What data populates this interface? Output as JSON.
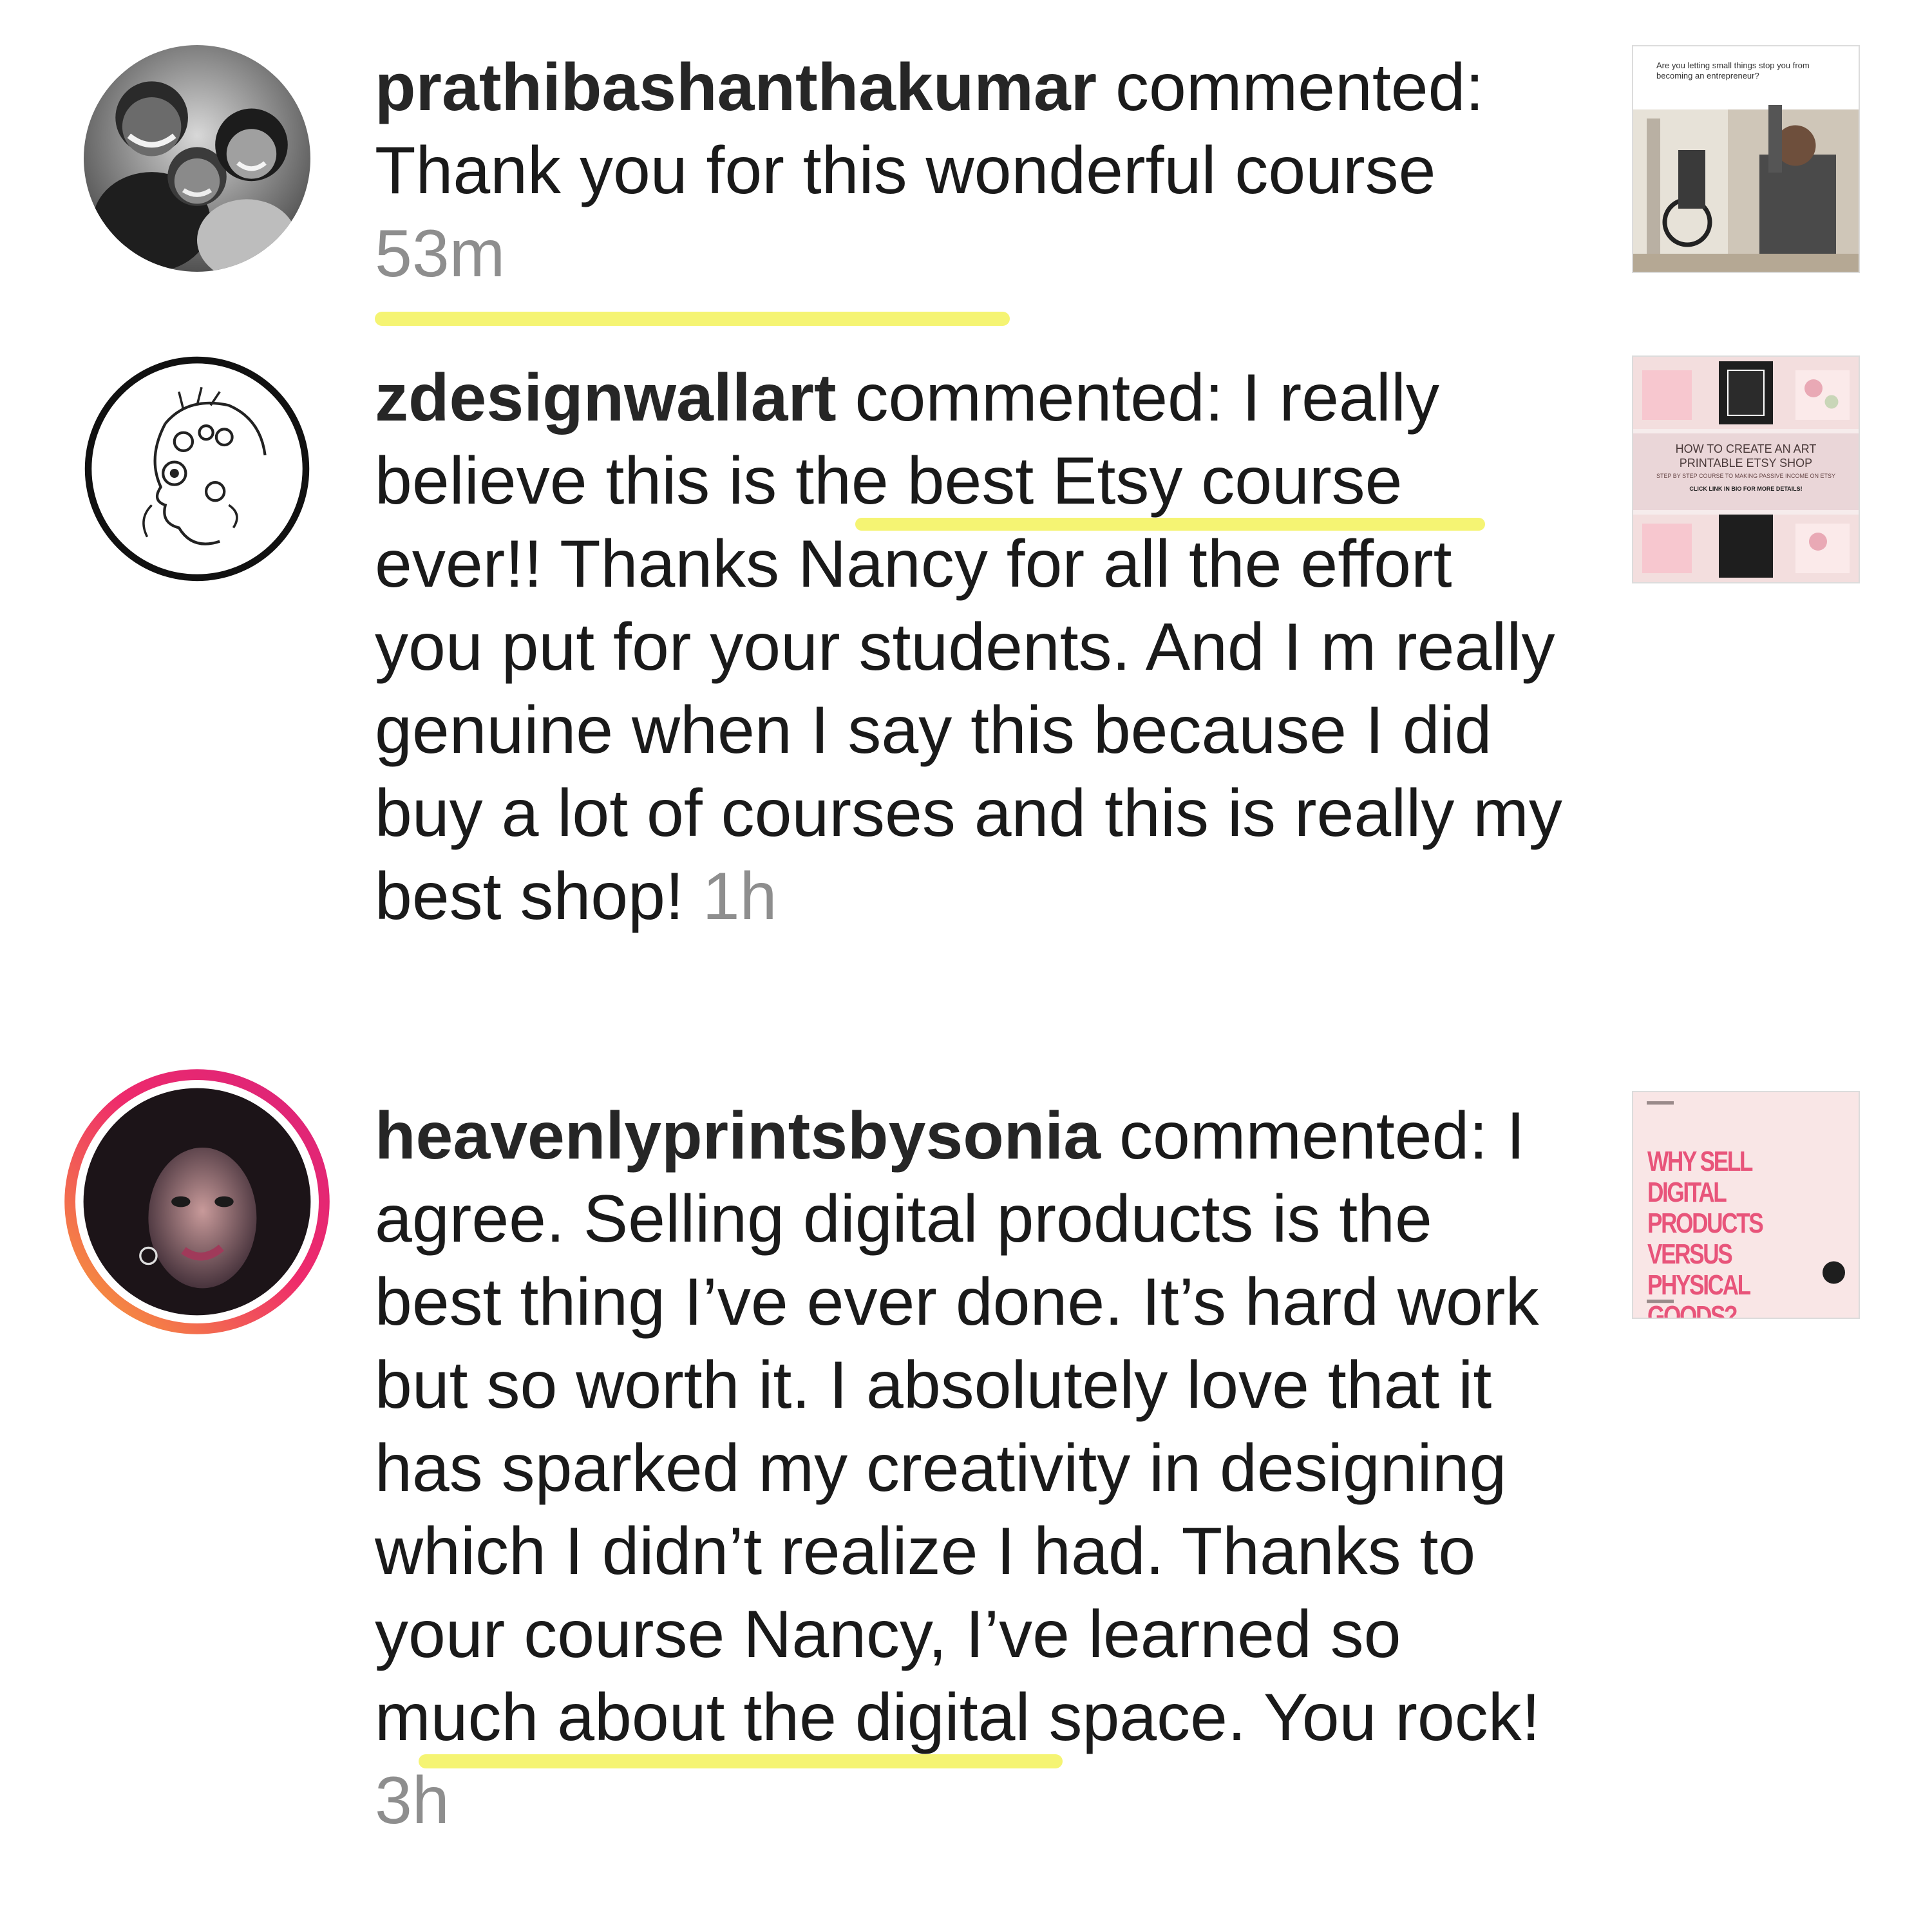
{
  "notifications": [
    {
      "username": "prathibashanthakumar",
      "action": " commented: ",
      "comment": "Thank you for this wonderful course",
      "time": "53m",
      "thumbnail_text": "Are you letting small things stop you from becoming an entrepreneur?"
    },
    {
      "username": "zdesignwallart",
      "action": " commented: ",
      "comment": "I really believe this is the best Etsy course ever!! Thanks Nancy for all the effort you put for your students. And I m really genuine when I say this because I did buy a lot of courses and this is really my best shop!",
      "time": "1h",
      "thumbnail_title": "HOW TO CREATE AN ART PRINTABLE ETSY SHOP",
      "thumbnail_sub": "STEP BY STEP COURSE TO MAKING PASSIVE INCOME ON ETSY",
      "thumbnail_cta": "CLICK LINK IN BIO FOR MORE DETAILS!"
    },
    {
      "username": "heavenlyprintsbysonia",
      "action": " commented: ",
      "comment": "I agree. Selling digital products is the best thing I’ve ever done. It’s hard work but so worth it. I absolutely love that it has sparked my creativity in designing which I didn’t realize I had. Thanks to your course Nancy, I’ve learned so much about the digital space. You rock!",
      "time": "3h",
      "thumbnail_title": "WHY SELL DIGITAL PRODUCTS VERSUS PHYSICAL GOODS?"
    }
  ],
  "colors": {
    "highlight": "#f4f36c",
    "timestamp": "#8e8e8e",
    "story_ring_start": "#f58529",
    "story_ring_end": "#dd2a7b",
    "thumb_pink_text": "#e8547a"
  }
}
